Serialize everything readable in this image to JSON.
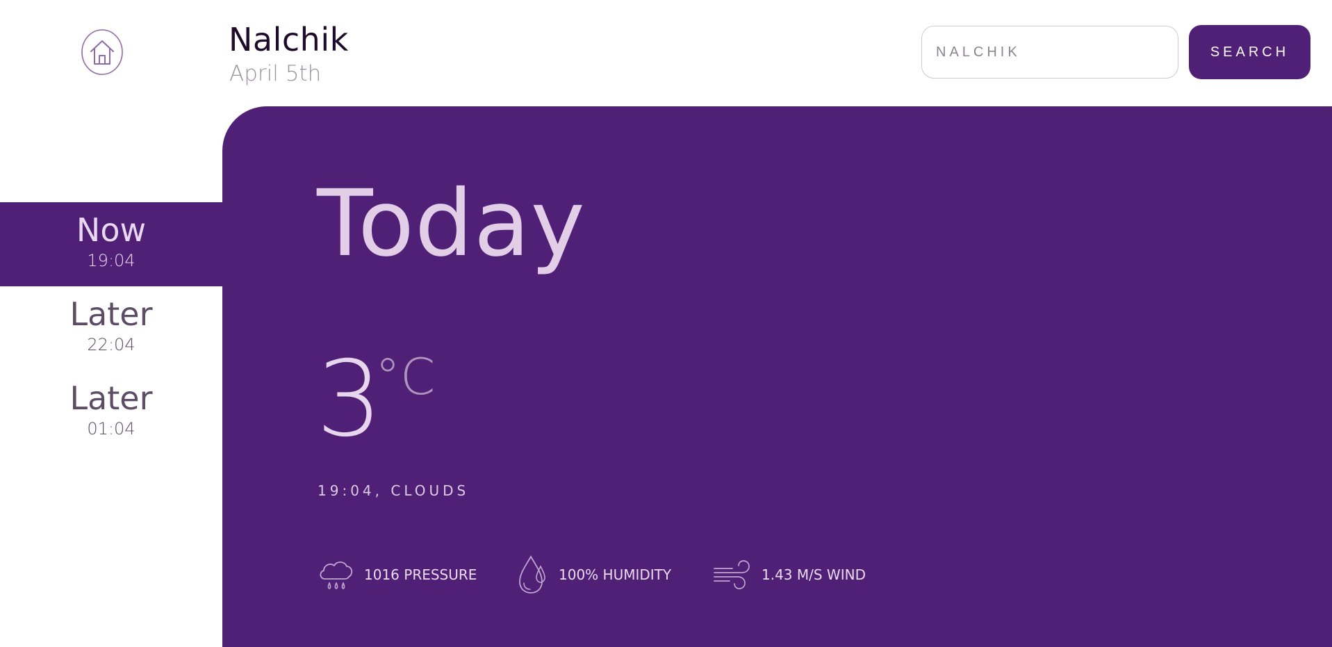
{
  "header": {
    "city": "Nalchik",
    "date": "April 5th"
  },
  "search": {
    "value": "NALCHIK",
    "button_label": "SEARCH"
  },
  "sidebar": {
    "items": [
      {
        "label": "Now",
        "time": "19:04",
        "active": true
      },
      {
        "label": "Later",
        "time": "22:04",
        "active": false
      },
      {
        "label": "Later",
        "time": "01:04",
        "active": false
      }
    ]
  },
  "main": {
    "heading": "Today",
    "temperature": "3",
    "unit": "°C",
    "summary": "19:04, CLOUDS",
    "stats": {
      "pressure": "1016 PRESSURE",
      "humidity": "100% HUMIDITY",
      "wind": "1.43 M/S WIND"
    }
  },
  "colors": {
    "accent": "#501f76",
    "panel_text": "#e2cfe7",
    "sidebar_text": "#5c4c66"
  },
  "icons": {
    "home": "home-icon",
    "pressure": "rain-cloud-icon",
    "humidity": "water-drops-icon",
    "wind": "wind-icon"
  }
}
